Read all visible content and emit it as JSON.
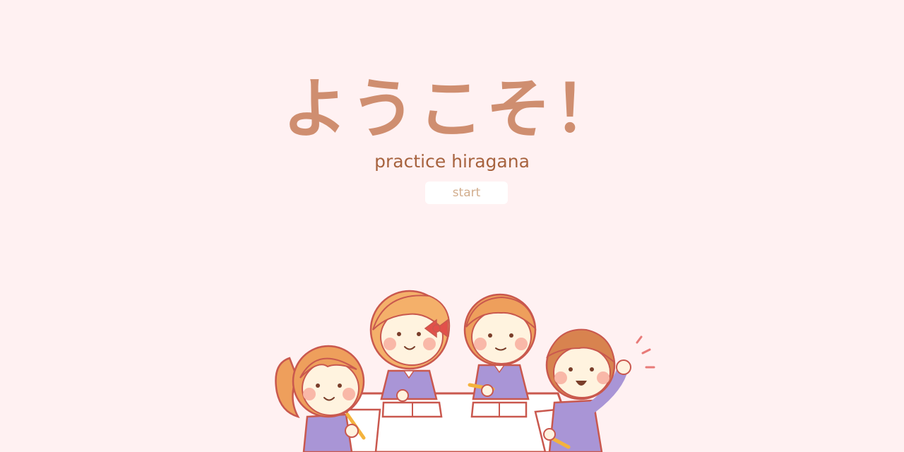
{
  "welcome": {
    "title": "ようこそ！",
    "subtitle": "practice hiragana",
    "start_label": "start"
  },
  "colors": {
    "background": "#fff1f2",
    "title": "#cf8e70",
    "subtitle": "#a7633f",
    "button_bg": "#ffffff",
    "button_text": "#d2ae8e"
  },
  "illustration": {
    "icon": "students-studying-illustration"
  }
}
